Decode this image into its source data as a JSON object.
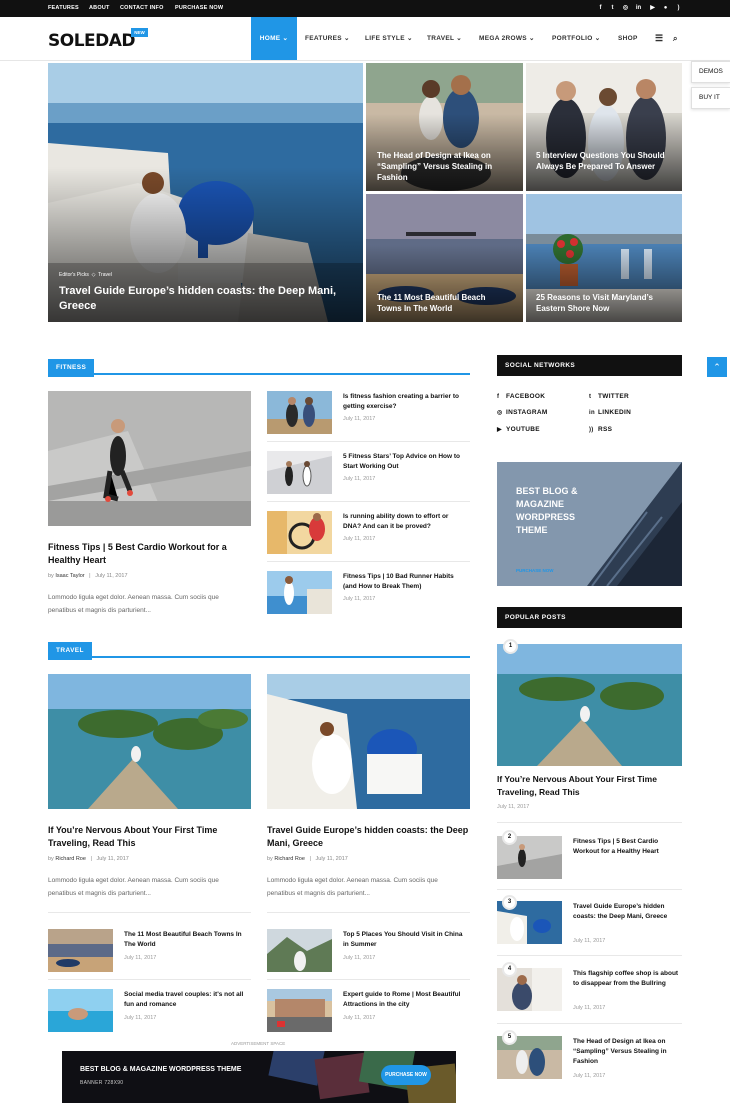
{
  "topbar": {
    "links": [
      "FEATURES",
      "ABOUT",
      "CONTACT INFO",
      "PURCHASE NOW"
    ]
  },
  "header": {
    "logo": "SOLEDAD",
    "badge": "NEW",
    "nav": [
      "HOME",
      "FEATURES",
      "LIFE STYLE",
      "TRAVEL",
      "MEGA 2ROWS",
      "PORTFOLIO",
      "SHOP"
    ]
  },
  "side_buttons": {
    "demos": "DEMOS",
    "buy": "BUY IT"
  },
  "hero": {
    "main": {
      "category1": "Editor's Picks",
      "category2": "Travel",
      "title": "Travel Guide Europe’s hidden coasts: the Deep Mani, Greece"
    },
    "tiles": [
      {
        "title": "The Head of Design at Ikea on “Sampling” Versus Stealing in Fashion"
      },
      {
        "title": "5 Interview Questions You Should Always Be Prepared To Answer"
      },
      {
        "title": "The 11 Most Beautiful Beach Towns In The World"
      },
      {
        "title": "25 Reasons to Visit Maryland’s Eastern Shore Now"
      }
    ]
  },
  "fitness": {
    "heading": "FITNESS",
    "featured": {
      "title": "Fitness Tips | 5 Best Cardio Workout for a Healthy Heart",
      "author_prefix": "by",
      "author": "Isaac Taylor",
      "date": "July 11, 2017",
      "excerpt": "Lommodo ligula eget dolor. Aenean massa. Cum sociis que penatibus et magnis dis parturient..."
    },
    "list": [
      {
        "title": "Is fitness fashion creating a barrier to getting exercise?",
        "date": "July 11, 2017"
      },
      {
        "title": "5 Fitness Stars’ Top Advice on How to Start Working Out",
        "date": "July 11, 2017"
      },
      {
        "title": "Is running ability down to effort or DNA? And can it be proved?",
        "date": "July 11, 2017"
      },
      {
        "title": "Fitness Tips | 10 Bad Runner Habits (and How to Break Them)",
        "date": "July 11, 2017"
      }
    ]
  },
  "travel": {
    "heading": "TRAVEL",
    "featured": [
      {
        "title": "If You’re Nervous About Your First Time Traveling, Read This",
        "author_prefix": "by",
        "author": "Richard Roe",
        "date": "July 11, 2017",
        "excerpt": "Lommodo ligula eget dolor. Aenean massa. Cum sociis que penatibus et magnis dis parturient..."
      },
      {
        "title": "Travel Guide Europe’s hidden coasts: the Deep Mani, Greece",
        "author_prefix": "by",
        "author": "Richard Roe",
        "date": "July 11, 2017",
        "excerpt": "Lommodo ligula eget dolor. Aenean massa. Cum sociis que penatibus et magnis dis parturient..."
      }
    ],
    "list": [
      {
        "title": "The 11 Most Beautiful Beach Towns In The World",
        "date": "July 11, 2017"
      },
      {
        "title": "Top 5 Places You Should Visit in China in Summer",
        "date": "July 11, 2017"
      },
      {
        "title": "Social media travel couples: it's not all fun and romance",
        "date": "July 11, 2017"
      },
      {
        "title": "Expert guide to Rome | Most Beautiful Attractions in the city",
        "date": "July 11, 2017"
      }
    ]
  },
  "sidebar": {
    "social_heading": "SOCIAL NETWORKS",
    "social": [
      {
        "icon": "facebook-icon",
        "glyph": "f",
        "label": "FACEBOOK"
      },
      {
        "icon": "twitter-icon",
        "glyph": "t",
        "label": "TWITTER"
      },
      {
        "icon": "instagram-icon",
        "glyph": "◎",
        "label": "INSTAGRAM"
      },
      {
        "icon": "linkedin-icon",
        "glyph": "in",
        "label": "LINKEDIN"
      },
      {
        "icon": "youtube-icon",
        "glyph": "▶",
        "label": "YOUTUBE"
      },
      {
        "icon": "rss-icon",
        "glyph": "))",
        "label": "RSS"
      }
    ],
    "banner": {
      "title": "BEST BLOG & MAGAZINE WORDPRESS THEME",
      "cta": "PURCHASE NOW"
    },
    "popular_heading": "POPULAR POSTS",
    "popular_featured": {
      "num": "1",
      "title": "If You’re Nervous About Your First Time Traveling, Read This",
      "date": "July 11, 2017"
    },
    "popular": [
      {
        "num": "2",
        "title": "Fitness Tips | 5 Best Cardio Workout for a Healthy Heart",
        "date": "July 11, 2017"
      },
      {
        "num": "3",
        "title": "Travel Guide Europe’s hidden coasts: the Deep Mani, Greece",
        "date": "July 11, 2017"
      },
      {
        "num": "4",
        "title": "This flagship coffee shop is about to disappear from the Bullring",
        "date": "July 11, 2017"
      },
      {
        "num": "5",
        "title": "The Head of Design at Ikea on “Sampling” Versus Stealing in Fashion",
        "date": "July 11, 2017"
      }
    ]
  },
  "ad": {
    "label": "ADVERTISEMENT SPACE",
    "title": "BEST BLOG & MAGAZINE WORDPRESS THEME",
    "sub": "BANNER 728X90",
    "cta": "PURCHASE NOW"
  },
  "colors": {
    "accent": "#2096e6",
    "dark": "#111111"
  }
}
